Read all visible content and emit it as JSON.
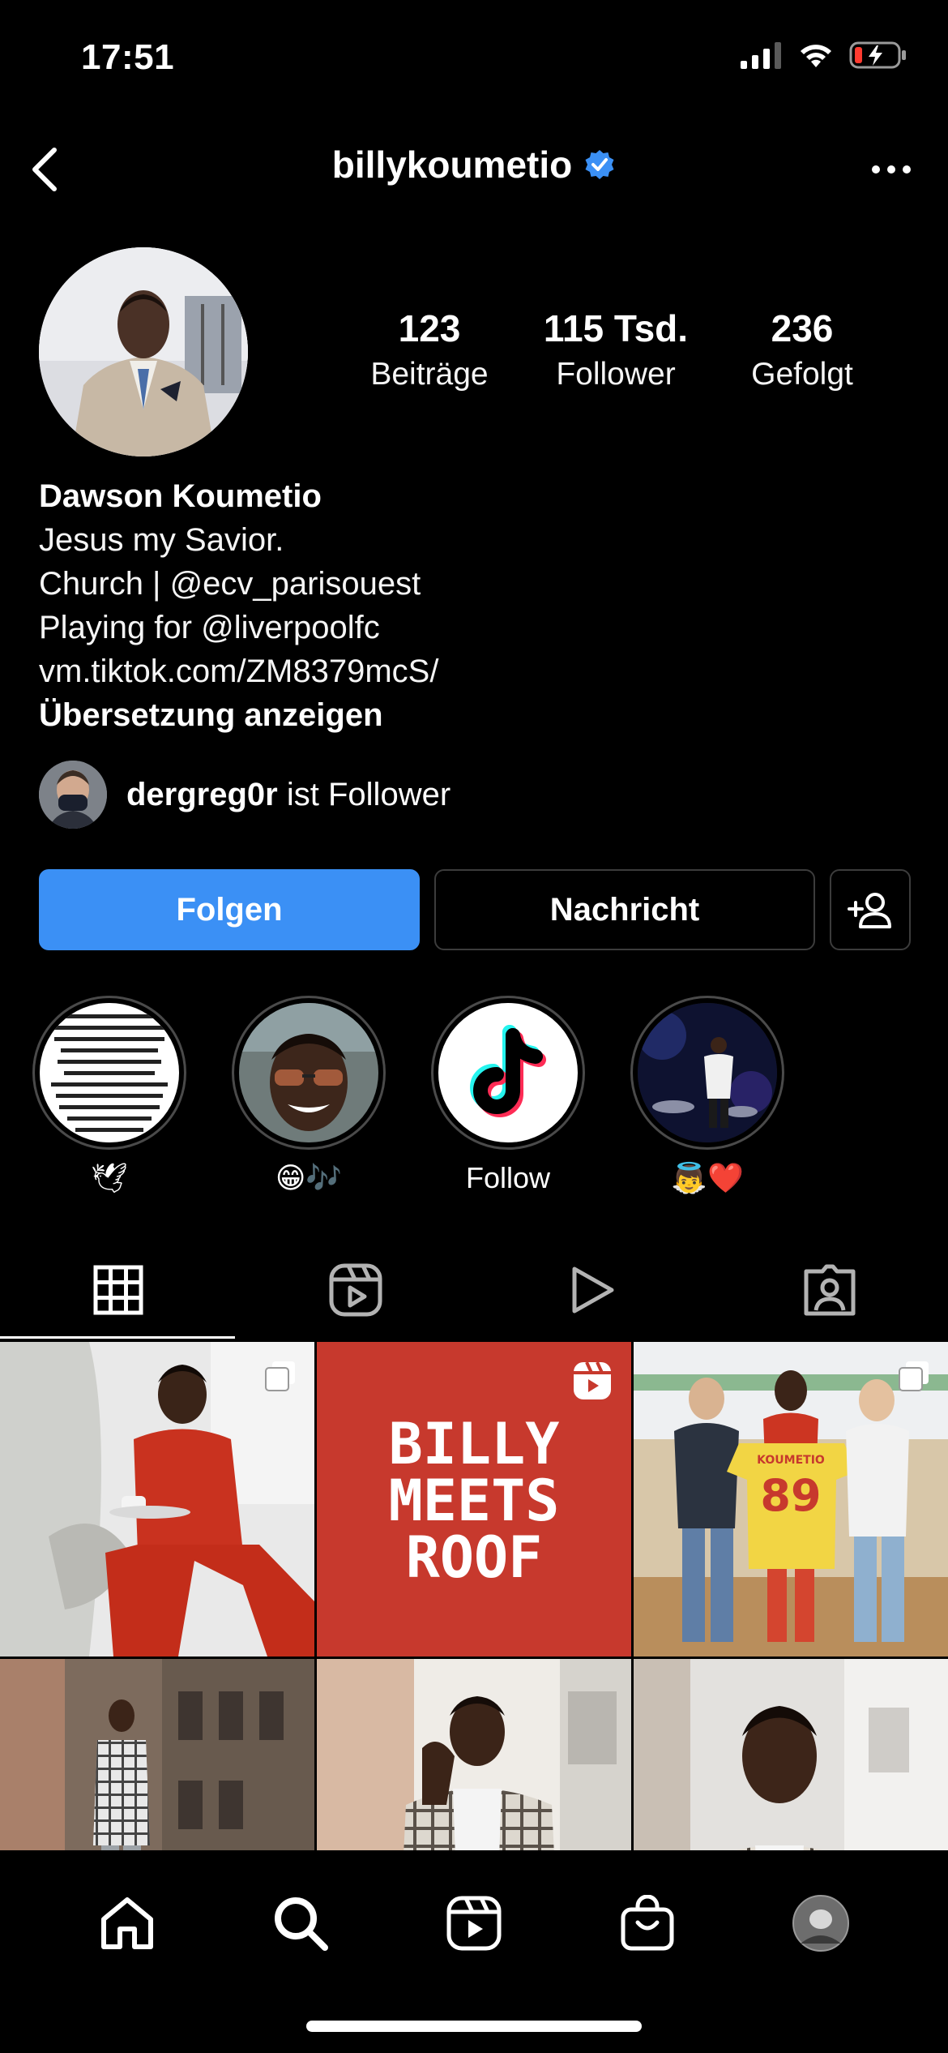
{
  "status_bar": {
    "time": "17:51"
  },
  "nav": {
    "username": "billykoumetio"
  },
  "stats": [
    {
      "value": "123",
      "label": "Beiträge"
    },
    {
      "value": "115 Tsd.",
      "label": "Follower"
    },
    {
      "value": "236",
      "label": "Gefolgt"
    }
  ],
  "bio": {
    "name": "Dawson Koumetio",
    "lines": [
      "Jesus my Savior.",
      "Church | @ecv_parisouest",
      "Playing for @liverpoolfc",
      "vm.tiktok.com/ZM8379mcS/"
    ],
    "translate": "Übersetzung anzeigen"
  },
  "followed_by": {
    "user": "dergreg0r",
    "suffix": "ist Follower"
  },
  "buttons": {
    "follow": "Folgen",
    "message": "Nachricht"
  },
  "highlights": [
    {
      "label": "🕊",
      "icon": "bible-verse"
    },
    {
      "label": "😁🎶",
      "icon": "selfie"
    },
    {
      "label": "Follow",
      "icon": "tiktok-logo"
    },
    {
      "label": "👼❤️",
      "icon": "stage-performer"
    }
  ],
  "post_text": {
    "reel_title_1": "BILLY",
    "reel_title_2": "MEETS",
    "reel_title_3": "ROOF",
    "jersey_name": "KOUMETIO",
    "jersey_number": "89"
  },
  "colors": {
    "follow_button": "#3b90f5",
    "verified": "#3b90f5",
    "reel_bg": "#c7392d",
    "battery_low": "#ff3b30"
  }
}
